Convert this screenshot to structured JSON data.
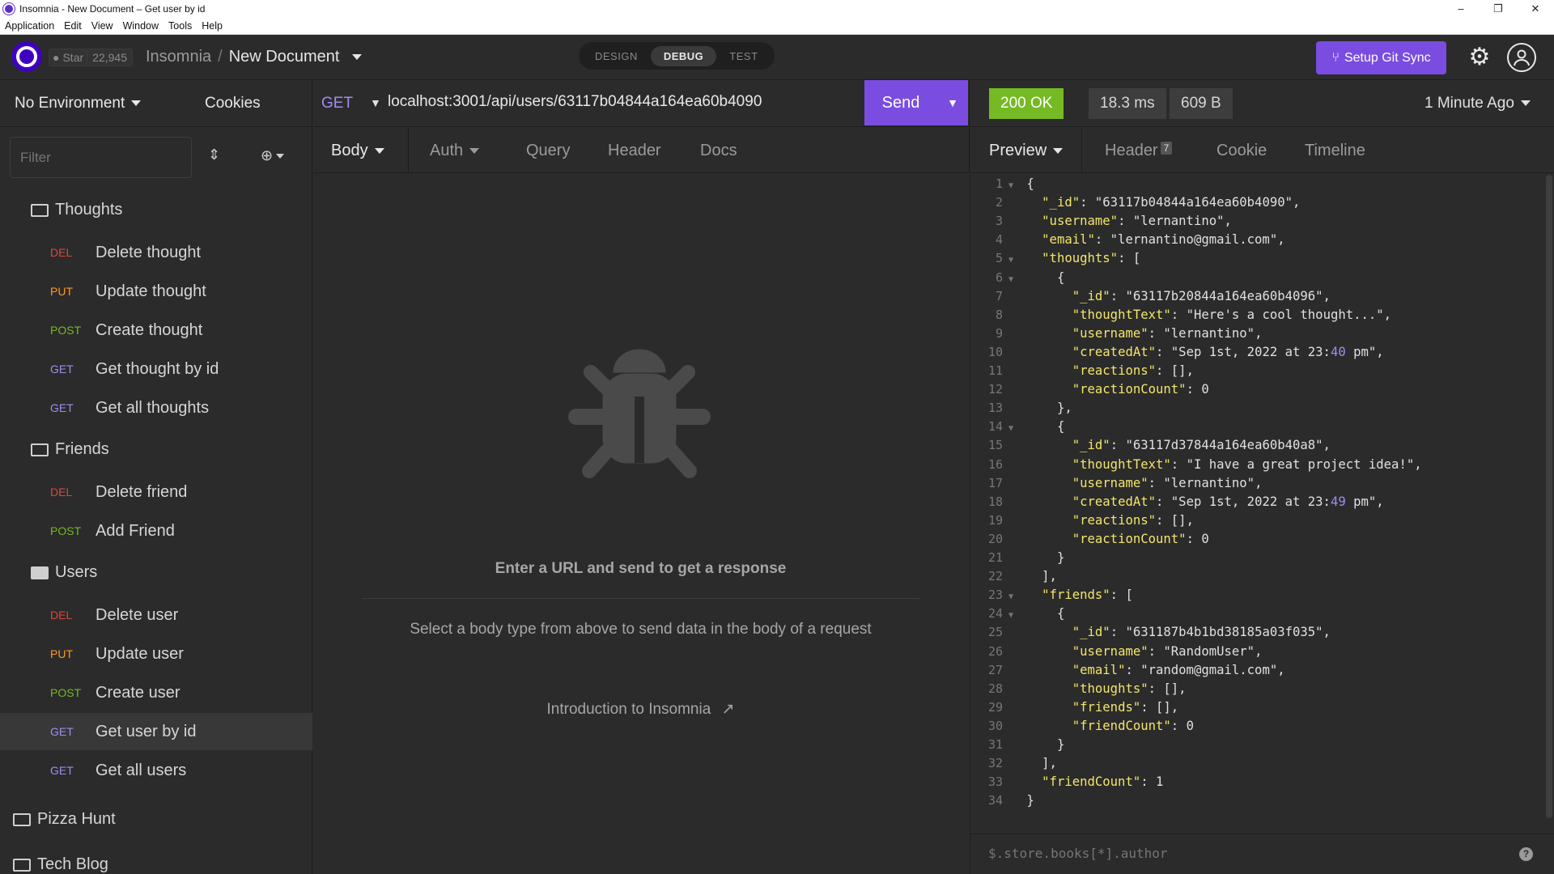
{
  "window": {
    "title": "Insomnia - New Document – Get user by id",
    "controls": [
      "–",
      "❐",
      "✕"
    ]
  },
  "menu": [
    "Application",
    "Edit",
    "View",
    "Window",
    "Tools",
    "Help"
  ],
  "header": {
    "github_star_label": "Star",
    "github_star_count": "22,945",
    "breadcrumb_root": "Insomnia",
    "breadcrumb_sep": "/",
    "breadcrumb_doc": "New Document",
    "modes": [
      "DESIGN",
      "DEBUG",
      "TEST"
    ],
    "active_mode": "DEBUG",
    "git_sync_label": "Setup Git Sync"
  },
  "sidebar": {
    "environment": "No Environment",
    "cookies": "Cookies",
    "filter_placeholder": "Filter",
    "folders": [
      {
        "name": "Thoughts",
        "requests": [
          {
            "method": "DEL",
            "name": "Delete thought"
          },
          {
            "method": "PUT",
            "name": "Update thought"
          },
          {
            "method": "POST",
            "name": "Create thought"
          },
          {
            "method": "GET",
            "name": "Get thought by id"
          },
          {
            "method": "GET",
            "name": "Get all thoughts"
          }
        ]
      },
      {
        "name": "Friends",
        "requests": [
          {
            "method": "DEL",
            "name": "Delete friend"
          },
          {
            "method": "POST",
            "name": "Add Friend"
          }
        ]
      },
      {
        "name": "Users",
        "requests": [
          {
            "method": "DEL",
            "name": "Delete user"
          },
          {
            "method": "PUT",
            "name": "Update user"
          },
          {
            "method": "POST",
            "name": "Create user"
          },
          {
            "method": "GET",
            "name": "Get user by id"
          },
          {
            "method": "GET",
            "name": "Get all users"
          }
        ]
      }
    ],
    "workspaces": [
      "Pizza Hunt",
      "Tech Blog"
    ]
  },
  "request": {
    "method": "GET",
    "url": "localhost:3001/api/users/63117b04844a164ea60b4090",
    "send_label": "Send",
    "tabs": [
      "Body",
      "Auth",
      "Query",
      "Header",
      "Docs"
    ],
    "empty_title": "Enter a URL and send to get a response",
    "empty_desc": "Select a body type from above to send data in the body of a request",
    "intro_link": "Introduction to Insomnia"
  },
  "response": {
    "status": "200 OK",
    "time": "18.3 ms",
    "size": "609 B",
    "age": "1 Minute Ago",
    "tabs": [
      "Preview",
      "Header",
      "Cookie",
      "Timeline"
    ],
    "header_count": "7",
    "filter_placeholder": "$.store.books[*].author",
    "lines": [
      "{",
      "  \"_id\": \"63117b04844a164ea60b4090\",",
      "  \"username\": \"lernantino\",",
      "  \"email\": \"lernantino@gmail.com\",",
      "  \"thoughts\": [",
      "    {",
      "      \"_id\": \"63117b20844a164ea60b4096\",",
      "      \"thoughtText\": \"Here's a cool thought...\",",
      "      \"username\": \"lernantino\",",
      "      \"createdAt\": \"Sep 1st, 2022 at 23:40 pm\",",
      "      \"reactions\": [],",
      "      \"reactionCount\": 0",
      "    },",
      "    {",
      "      \"_id\": \"63117d37844a164ea60b40a8\",",
      "      \"thoughtText\": \"I have a great project idea!\",",
      "      \"username\": \"lernantino\",",
      "      \"createdAt\": \"Sep 1st, 2022 at 23:49 pm\",",
      "      \"reactions\": [],",
      "      \"reactionCount\": 0",
      "    }",
      "  ],",
      "  \"friends\": [",
      "    {",
      "      \"_id\": \"631187b4b1bd38185a03f035\",",
      "      \"username\": \"RandomUser\",",
      "      \"email\": \"random@gmail.com\",",
      "      \"thoughts\": [],",
      "      \"friends\": [],",
      "      \"friendCount\": 0",
      "    }",
      "  ],",
      "  \"friendCount\": 1",
      "}"
    ],
    "foldable_lines": [
      1,
      5,
      6,
      14,
      23,
      24
    ]
  },
  "colors": {
    "accent": "#7a4de0",
    "status_ok": "#75ba24",
    "del": "#e0453a",
    "put": "#ff9a1f",
    "post": "#75ba24",
    "get": "#a28bef"
  }
}
